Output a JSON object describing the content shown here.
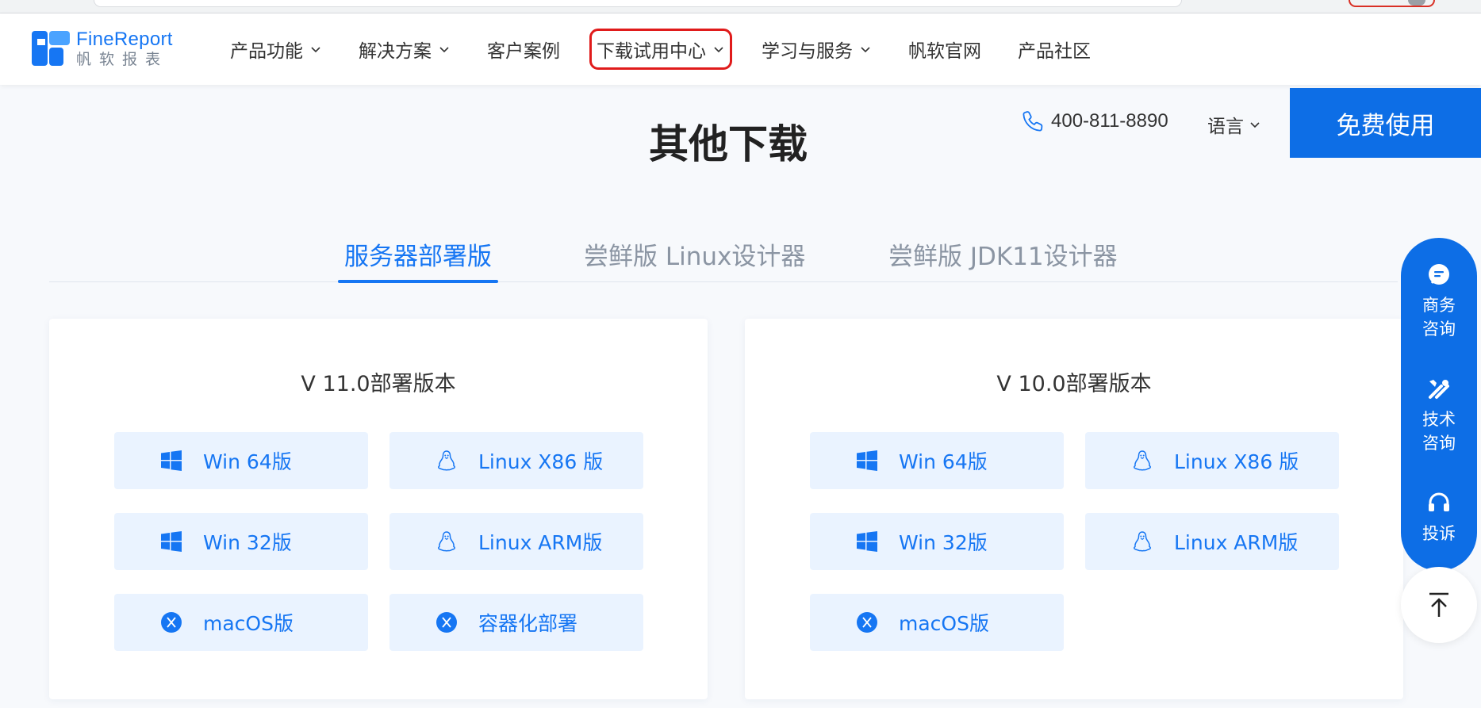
{
  "brand": {
    "name_en": "FineReport",
    "name_cn": "帆软报表",
    "color": "#1676f3"
  },
  "nav": [
    {
      "label": "产品功能",
      "dropdown": true
    },
    {
      "label": "解决方案",
      "dropdown": true
    },
    {
      "label": "客户案例",
      "dropdown": false
    },
    {
      "label": "下载试用中心",
      "dropdown": true,
      "highlighted": true
    },
    {
      "label": "学习与服务",
      "dropdown": true
    },
    {
      "label": "帆软官网",
      "dropdown": false
    },
    {
      "label": "产品社区",
      "dropdown": false
    }
  ],
  "topbar": {
    "phone": "400-811-8890",
    "language": "语言",
    "cta": "免费使用"
  },
  "page": {
    "title": "其他下载"
  },
  "tabs": [
    {
      "label": "服务器部署版",
      "active": true
    },
    {
      "label": "尝鲜版 Linux设计器",
      "active": false
    },
    {
      "label": "尝鲜版 JDK11设计器",
      "active": false
    }
  ],
  "cards": [
    {
      "title": "V 11.0部署版本",
      "buttons": [
        {
          "label": "Win 64版",
          "icon": "windows-icon"
        },
        {
          "label": "Linux X86 版",
          "icon": "linux-icon"
        },
        {
          "label": "Win 32版",
          "icon": "windows-icon"
        },
        {
          "label": "Linux ARM版",
          "icon": "linux-icon"
        },
        {
          "label": "macOS版",
          "icon": "macos-icon"
        },
        {
          "label": "容器化部署",
          "icon": "container-icon"
        }
      ]
    },
    {
      "title": "V 10.0部署版本",
      "buttons": [
        {
          "label": "Win 64版",
          "icon": "windows-icon"
        },
        {
          "label": "Linux X86 版",
          "icon": "linux-icon"
        },
        {
          "label": "Win 32版",
          "icon": "windows-icon"
        },
        {
          "label": "Linux ARM版",
          "icon": "linux-icon"
        },
        {
          "label": "macOS版",
          "icon": "macos-icon"
        }
      ]
    }
  ],
  "side": {
    "business": "商务咨询",
    "tech": "技术咨询",
    "complaint": "投诉"
  },
  "colors": {
    "accent": "#1676f3",
    "cta_bg": "#0d6ee6",
    "button_bg": "#eaf3ff",
    "highlight_box": "#e01b1b"
  }
}
